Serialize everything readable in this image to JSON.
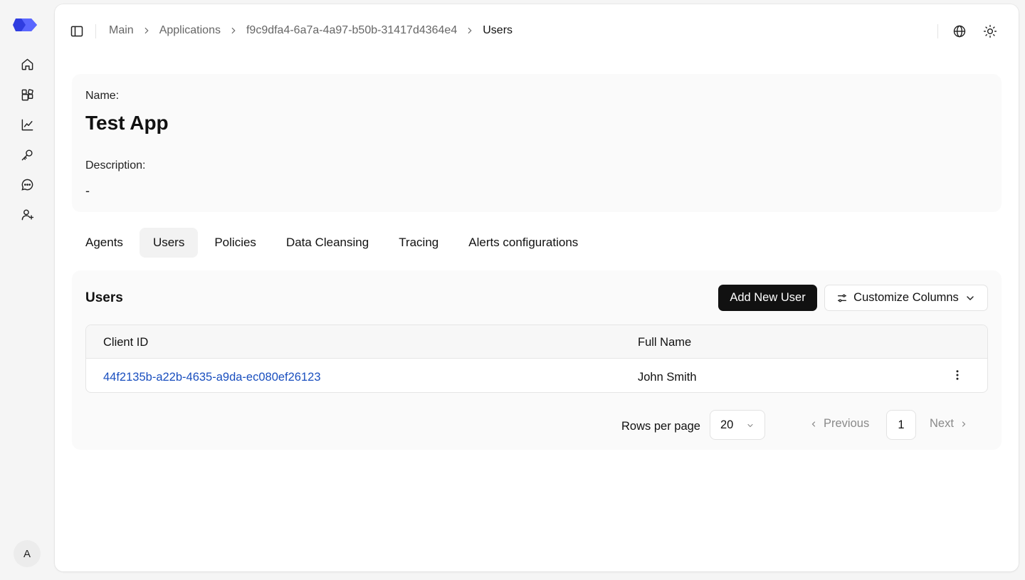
{
  "rail": {
    "items": [
      {
        "name": "home-icon"
      },
      {
        "name": "apps-icon"
      },
      {
        "name": "chart-icon"
      },
      {
        "name": "key-icon"
      },
      {
        "name": "chat-icon"
      },
      {
        "name": "user-plus-icon"
      }
    ],
    "avatar": "A"
  },
  "breadcrumb": {
    "items": [
      "Main",
      "Applications",
      "f9c9dfa4-6a7a-4a97-b50b-31417d4364e4"
    ],
    "current": "Users"
  },
  "app": {
    "name_label": "Name:",
    "name": "Test App",
    "description_label": "Description:",
    "description": "-"
  },
  "tabs": [
    {
      "label": "Agents",
      "active": false
    },
    {
      "label": "Users",
      "active": true
    },
    {
      "label": "Policies",
      "active": false
    },
    {
      "label": "Data Cleansing",
      "active": false
    },
    {
      "label": "Tracing",
      "active": false
    },
    {
      "label": "Alerts configurations",
      "active": false
    }
  ],
  "users": {
    "title": "Users",
    "add_button": "Add New User",
    "customize_button": "Customize Columns",
    "columns": [
      "Client ID",
      "Full Name"
    ],
    "rows": [
      {
        "client_id": "44f2135b-a22b-4635-a9da-ec080ef26123",
        "full_name": "John Smith"
      }
    ],
    "pagination": {
      "rows_per_page_label": "Rows per page",
      "rows_per_page": "20",
      "previous": "Previous",
      "page": "1",
      "next": "Next"
    }
  },
  "colors": {
    "accent": "#3f4ef0",
    "link": "#1a4fbf",
    "primary_button": "#111111"
  }
}
